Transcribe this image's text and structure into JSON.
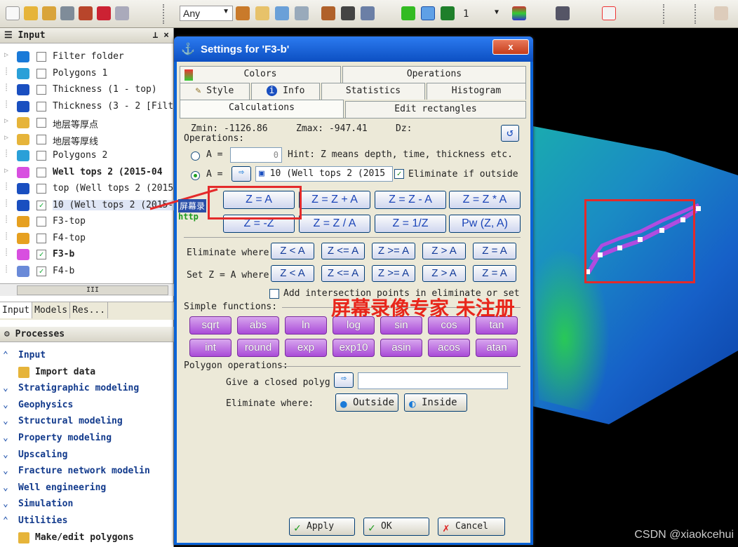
{
  "toolbar": {
    "select_value": "Any",
    "num_value": "1"
  },
  "input_pane": {
    "title": "Input",
    "items": [
      {
        "label": "Filter folder",
        "checked": false,
        "bold": false
      },
      {
        "label": "Polygons 1",
        "checked": false,
        "bold": false
      },
      {
        "label": "Thickness (1 - top)",
        "checked": false,
        "bold": false
      },
      {
        "label": "Thickness (3 - 2 [Filt",
        "checked": false,
        "bold": false
      },
      {
        "label": "地层等厚点",
        "checked": false,
        "bold": false
      },
      {
        "label": "地层等厚线",
        "checked": false,
        "bold": false
      },
      {
        "label": "Polygons 2",
        "checked": false,
        "bold": false
      },
      {
        "label": "Well tops 2 (2015-04",
        "checked": false,
        "bold": true
      },
      {
        "label": "top (Well tops 2 (2015-",
        "checked": false,
        "bold": false
      },
      {
        "label": "10 (Well tops 2 (2015-0",
        "checked": true,
        "bold": false
      },
      {
        "label": "F3-top",
        "checked": false,
        "bold": false
      },
      {
        "label": "F4-top",
        "checked": false,
        "bold": false
      },
      {
        "label": "F3-b",
        "checked": true,
        "bold": true
      },
      {
        "label": "F4-b",
        "checked": true,
        "bold": false
      }
    ],
    "scroll_grip": "III"
  },
  "pane_tabs": [
    "Input",
    "Models",
    "Res...",
    ""
  ],
  "processes": {
    "title": "Processes",
    "items": [
      {
        "label": "Input",
        "chev": "^"
      },
      {
        "label": "Import data",
        "chev": "",
        "sub": true
      },
      {
        "label": "Stratigraphic modeling",
        "chev": "v"
      },
      {
        "label": "Geophysics",
        "chev": "v"
      },
      {
        "label": "Structural modeling",
        "chev": "v"
      },
      {
        "label": "Property modeling",
        "chev": "v"
      },
      {
        "label": "Upscaling",
        "chev": "v"
      },
      {
        "label": "Fracture network modelin",
        "chev": "v"
      },
      {
        "label": "Well engineering",
        "chev": "v"
      },
      {
        "label": "Simulation",
        "chev": "v"
      },
      {
        "label": "Utilities",
        "chev": "^"
      },
      {
        "label": "Make/edit polygons",
        "chev": "",
        "sub": true
      }
    ]
  },
  "dialog": {
    "title": "Settings for 'F3-b'",
    "close_label": "x",
    "tabs_row1": [
      "Colors",
      "Operations"
    ],
    "tabs_row2": [
      "Style",
      "Info",
      "Statistics",
      "Histogram"
    ],
    "tabs_row3": [
      "Calculations",
      "Edit rectangles"
    ],
    "zmin_label": "Zmin:",
    "zmin_value": "-1126.86",
    "zmax_label": "Zmax:",
    "zmax_value": "-947.41",
    "dz_label": "Dz:",
    "operations_label": "Operations:",
    "a_label": "A =",
    "a_value": "0",
    "hint": "Hint: Z means depth, time, thickness etc.",
    "a2_label": "A =",
    "a2_object": "10 (Well tops 2 (2015",
    "eliminate_outside": "Eliminate if outside",
    "ops_row1": [
      "Z = A",
      "Z = Z + A",
      "Z = Z - A",
      "Z = Z * A"
    ],
    "ops_row2": [
      "Z = -Z",
      "Z = Z / A",
      "Z = 1/Z",
      "Pw (Z, A)"
    ],
    "eliminate_where_label": "Eliminate where",
    "setz_label": "Set Z = A where",
    "compare_ops": [
      "Z < A",
      "Z <= A",
      "Z >= A",
      "Z > A",
      "Z = A"
    ],
    "add_intersection": "Add intersection points in eliminate or set",
    "simple_functions_label": "Simple functions:",
    "funcs_row1": [
      "sqrt",
      "abs",
      "ln",
      "log",
      "sin",
      "cos",
      "tan"
    ],
    "funcs_row2": [
      "int",
      "round",
      "exp",
      "exp10",
      "asin",
      "acos",
      "atan"
    ],
    "polygon_ops_label": "Polygon operations:",
    "give_polygon": "Give a closed polyg",
    "eliminate_where2": "Eliminate where:",
    "outside_label": "Outside",
    "inside_label": "Inside",
    "apply_label": "Apply",
    "ok_label": "OK",
    "cancel_label": "Cancel"
  },
  "watermark": {
    "text": "屏幕录像专家 未注册",
    "small": "屏幕录",
    "url": "http"
  },
  "credit": "CSDN @xiaokcehui",
  "colors": {
    "title_bar": "#0c4fc2",
    "highlight_box": "#e42a2a",
    "func_button": "#a94bd8"
  }
}
